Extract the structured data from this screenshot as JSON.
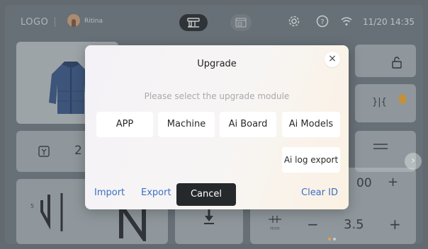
{
  "topbar": {
    "logo": "LOGO",
    "user_name": "Ritina",
    "clock": "11/20 14:35",
    "icons": [
      "user-avatar",
      "sewing-mode-icon",
      "pattern-mode-icon",
      "gear-icon",
      "help-icon",
      "wifi-icon"
    ]
  },
  "background": {
    "stitch_label_left": "2",
    "stitch_label_small": "5",
    "value_top": "00",
    "value_bottom": "3.5",
    "unit": "mm",
    "plus": "+",
    "minus": "−"
  },
  "dialog": {
    "title": "Upgrade",
    "close": "×",
    "subtitle": "Please select the upgrade module",
    "options": [
      "APP",
      "Machine",
      "Ai Board",
      "Ai Models"
    ],
    "log_export": "Ai log export",
    "import": "Import",
    "export": "Export",
    "cancel": "Cancel",
    "clear_id": "Clear ID"
  },
  "colors": {
    "link": "#3b6fc4",
    "cancel_bg": "#26292c",
    "active_dot": "#e9a33a"
  }
}
